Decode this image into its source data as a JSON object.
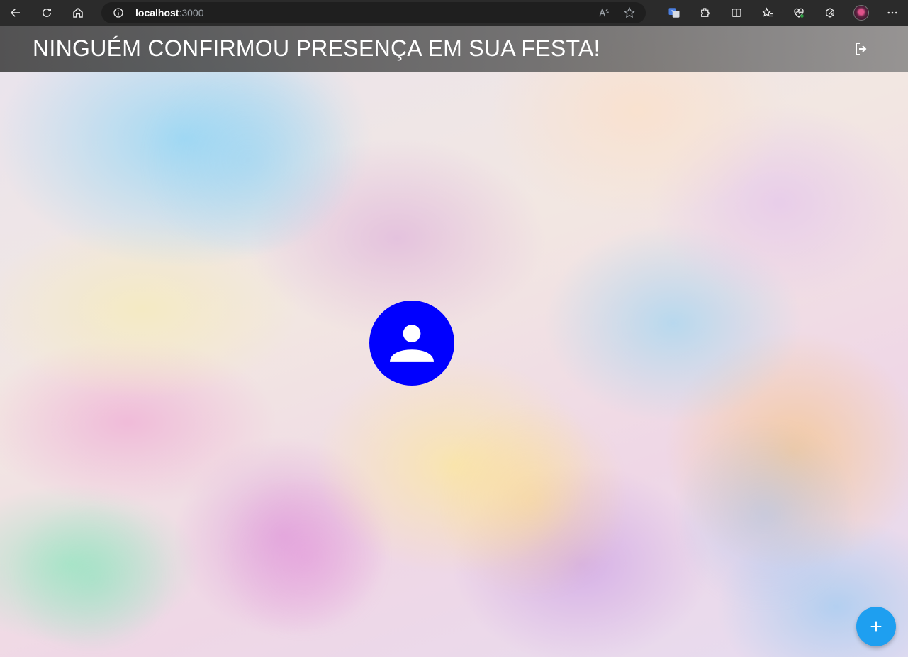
{
  "browser": {
    "url_host": "localhost",
    "url_port": ":3000",
    "icons": [
      "back-icon",
      "refresh-icon",
      "home-icon",
      "info-icon",
      "read-aloud-icon",
      "favorite-star-icon",
      "translate-icon",
      "extensions-icon",
      "split-screen-icon",
      "favorites-icon",
      "browser-essentials-icon",
      "copilot-icon",
      "profile-avatar",
      "more-icon"
    ]
  },
  "header": {
    "title": "NINGUÉM CONFIRMOU PRESENÇA EM SUA FESTA!",
    "logout_icon": "logout-icon"
  },
  "main": {
    "avatar_icon": "person-icon",
    "avatar_color": "#0000ff"
  },
  "fab": {
    "icon": "plus-icon",
    "color": "#1e9ff0"
  }
}
